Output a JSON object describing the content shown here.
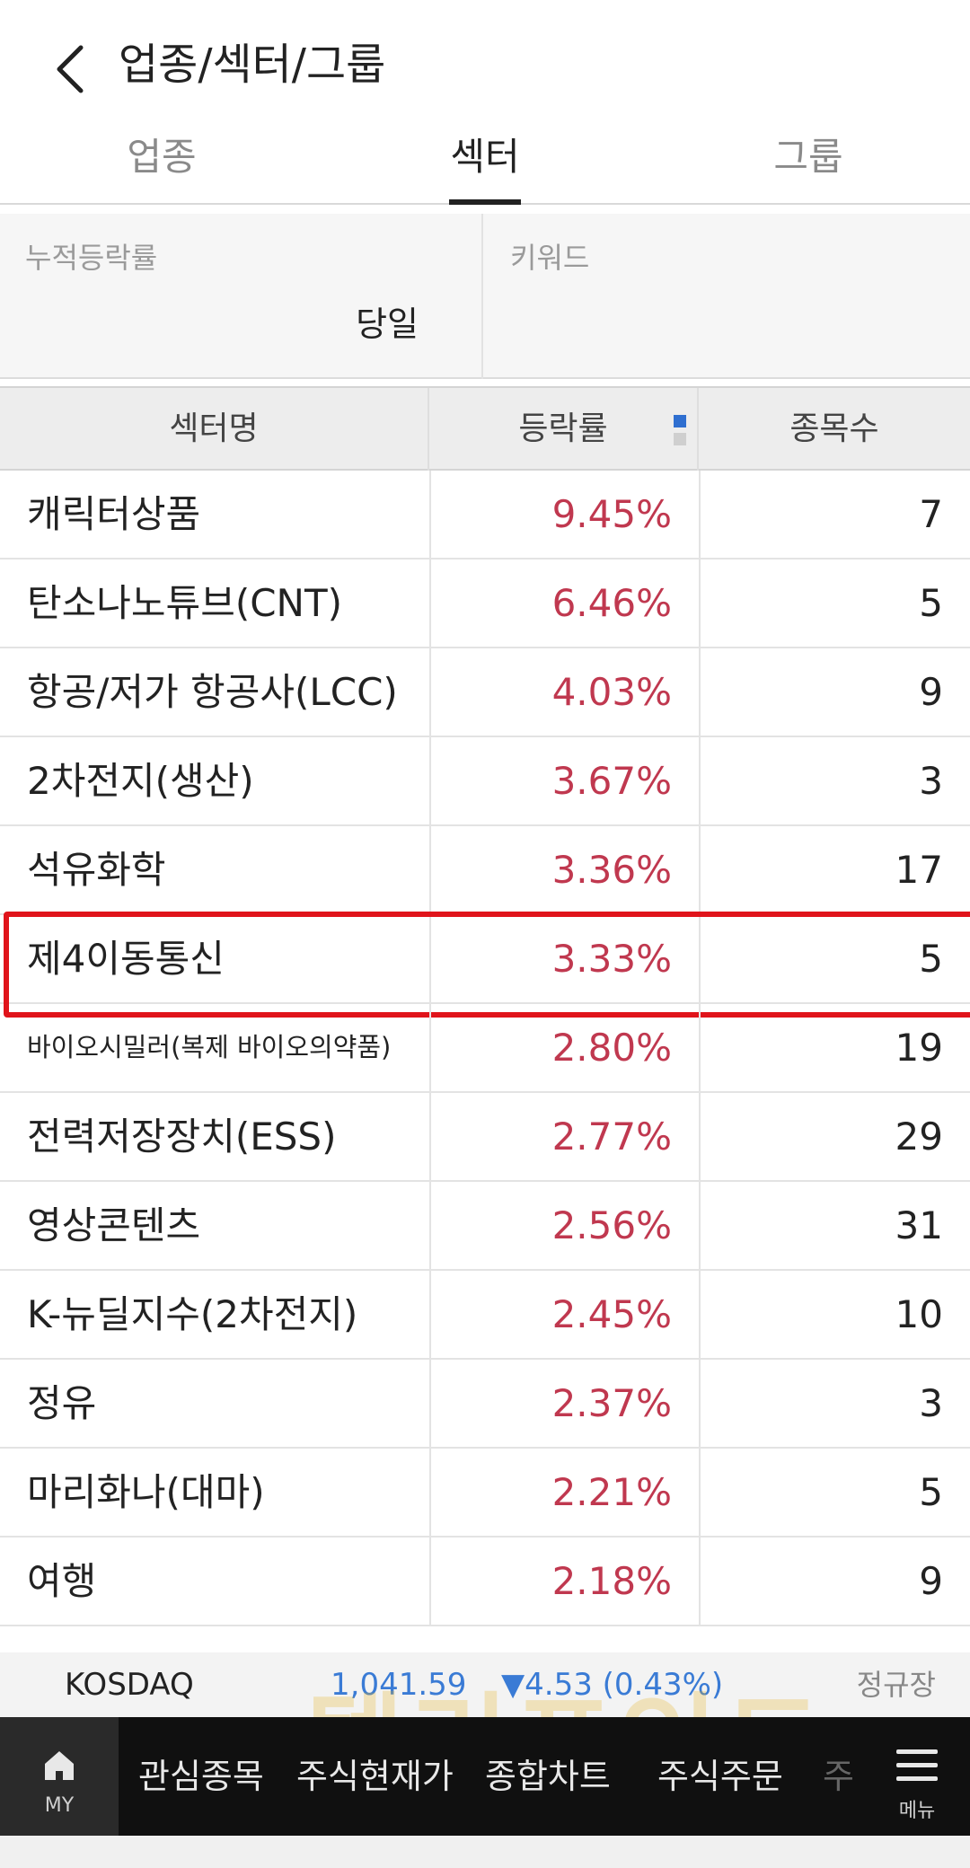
{
  "header": {
    "title": "업종/섹터/그룹",
    "back_icon": "chevron-left-icon"
  },
  "tabs": [
    {
      "label": "업종",
      "active": false
    },
    {
      "label": "섹터",
      "active": true
    },
    {
      "label": "그룹",
      "active": false
    }
  ],
  "filter": {
    "period_label": "누적등락률",
    "period_value": "당일",
    "keyword_label": "키워드"
  },
  "table": {
    "headers": {
      "name": "섹터명",
      "rate": "등락률",
      "count": "종목수"
    },
    "sort_colors": {
      "active": "#2f6fd0",
      "inactive": "#cfcfcf"
    },
    "rate_color": "#c0384f",
    "rows": [
      {
        "name": "캐릭터상품",
        "rate": "9.45%",
        "count": "7"
      },
      {
        "name": "탄소나노튜브(CNT)",
        "rate": "6.46%",
        "count": "5"
      },
      {
        "name": "항공/저가 항공사(LCC)",
        "rate": "4.03%",
        "count": "9"
      },
      {
        "name": "2차전지(생산)",
        "rate": "3.67%",
        "count": "3"
      },
      {
        "name": "석유화학",
        "rate": "3.36%",
        "count": "17"
      },
      {
        "name": "제4이동통신",
        "rate": "3.33%",
        "count": "5",
        "highlighted": true
      },
      {
        "name": "바이오시밀러(복제 바이오의약품)",
        "rate": "2.80%",
        "count": "19"
      },
      {
        "name": "전력저장장치(ESS)",
        "rate": "2.77%",
        "count": "29"
      },
      {
        "name": "영상콘텐츠",
        "rate": "2.56%",
        "count": "31"
      },
      {
        "name": "K-뉴딜지수(2차전지)",
        "rate": "2.45%",
        "count": "10"
      },
      {
        "name": "정유",
        "rate": "2.37%",
        "count": "3"
      },
      {
        "name": "마리화나(대마)",
        "rate": "2.21%",
        "count": "5"
      },
      {
        "name": "여행",
        "rate": "2.18%",
        "count": "9"
      }
    ]
  },
  "index_bar": {
    "name": "KOSDAQ",
    "value": "1,041.59",
    "change": "▼4.53 (0.43%)",
    "status": "정규장",
    "color": "#3a7bd5"
  },
  "watermark": "텔리포인트",
  "bottom_nav": {
    "my_label": "MY",
    "items": [
      "관심종목",
      "주식현재가",
      "종합차트",
      "주식주문",
      "주"
    ],
    "menu_label": "메뉴",
    "home_icon": "home-icon",
    "menu_icon": "hamburger-menu-icon"
  }
}
